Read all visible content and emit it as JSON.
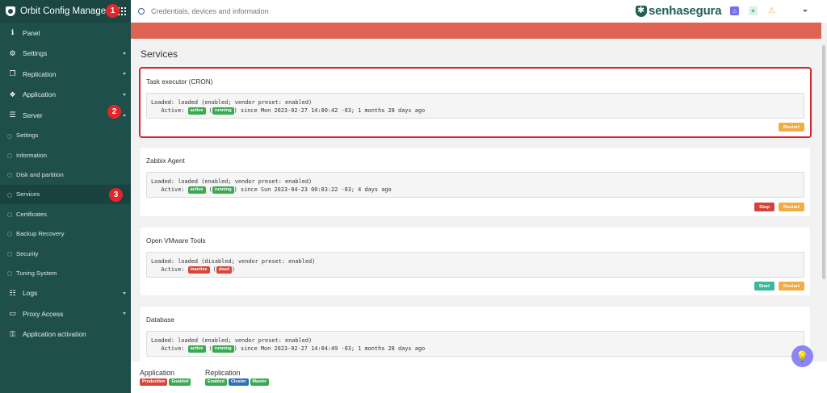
{
  "app": {
    "title": "Orbit Config Manager"
  },
  "sidebar": {
    "items": [
      {
        "label": "Panel",
        "icon": "info-icon"
      },
      {
        "label": "Settings",
        "icon": "cogs-icon"
      },
      {
        "label": "Replication",
        "icon": "copy-icon"
      },
      {
        "label": "Application",
        "icon": "cubes-icon"
      },
      {
        "label": "Server",
        "icon": "server-icon"
      }
    ],
    "server_sub": [
      {
        "label": "Settings"
      },
      {
        "label": "Information"
      },
      {
        "label": "Disk and partition"
      },
      {
        "label": "Services"
      },
      {
        "label": "Certificates"
      },
      {
        "label": "Backup Recovery"
      },
      {
        "label": "Security"
      },
      {
        "label": "Tuning System"
      }
    ],
    "bottom_items": [
      {
        "label": "Logs",
        "icon": "list-icon"
      },
      {
        "label": "Proxy Access",
        "icon": "monitor-icon"
      },
      {
        "label": "Application activation",
        "icon": "key-icon"
      }
    ]
  },
  "annotations": [
    "1",
    "2",
    "3"
  ],
  "search": {
    "placeholder": "Credentials, devices and information"
  },
  "brand": {
    "name": "senhasegura",
    "color": "#1f5f54"
  },
  "page": {
    "title": "Services"
  },
  "services": [
    {
      "name": "Task executor (CRON)",
      "loaded": "Loaded: loaded (enabled; vendor preset: enabled)",
      "active_prefix": "Active: ",
      "state": "active",
      "sub_state": "running",
      "since": " since Mon 2023-02-27 14:00:42 -03; 1 months 28 days ago",
      "buttons": [
        "Restart"
      ]
    },
    {
      "name": "Zabbix Agent",
      "loaded": "Loaded: loaded (enabled; vendor preset: enabled)",
      "active_prefix": "Active: ",
      "state": "active",
      "sub_state": "running",
      "since": " since Sun 2023-04-23 00:03:22 -03; 4 days ago",
      "buttons": [
        "Stop",
        "Restart"
      ]
    },
    {
      "name": "Open VMware Tools",
      "loaded": "Loaded: loaded (disabled; vendor preset: enabled)",
      "active_prefix": "Active: ",
      "state": "inactive",
      "sub_state": "dead",
      "since": "",
      "buttons": [
        "Start",
        "Restart"
      ]
    },
    {
      "name": "Database",
      "loaded": "Loaded: loaded (enabled; vendor preset: enabled)",
      "active_prefix": "Active: ",
      "state": "active",
      "sub_state": "running",
      "since": " since Mon 2023-02-27 14:04:49 -03; 1 months 28 days ago",
      "buttons": []
    }
  ],
  "footer": {
    "application": {
      "label": "Application",
      "tags": [
        "Production",
        "Enabled"
      ]
    },
    "replication": {
      "label": "Replication",
      "tags": [
        "Enabled",
        "Cluster",
        "Master"
      ]
    }
  },
  "colors": {
    "sidebar": "#1f4f4a",
    "alert": "#df6353",
    "active": "#3aaa52",
    "inactive": "#d9453c",
    "restart": "#efac47"
  }
}
